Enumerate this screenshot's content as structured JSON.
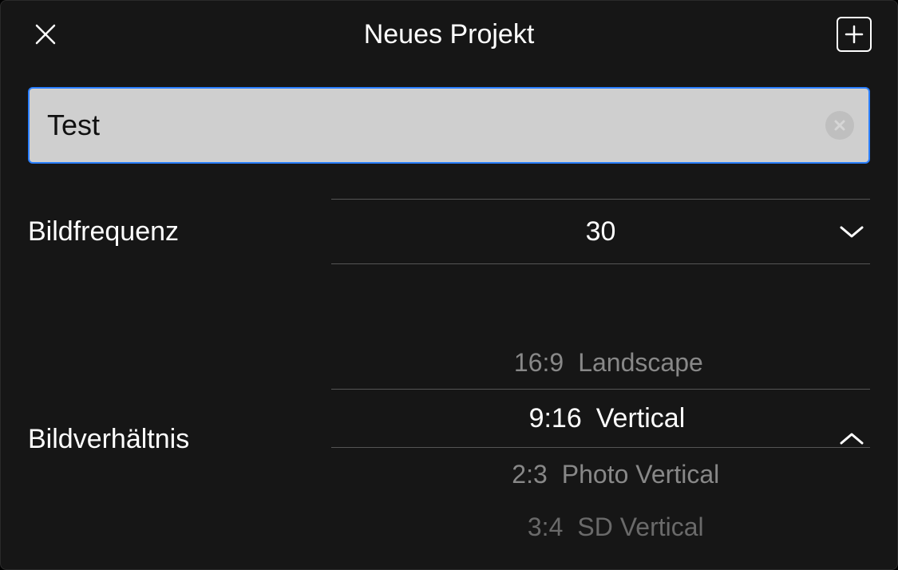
{
  "header": {
    "title": "Neues Projekt"
  },
  "project": {
    "name_value": "Test"
  },
  "framerate": {
    "label": "Bildfrequenz",
    "value": "30"
  },
  "aspect": {
    "label": "Bildverhältnis",
    "options": [
      {
        "ratio": "16:9",
        "name": "Landscape"
      },
      {
        "ratio": "9:16",
        "name": "Vertical"
      },
      {
        "ratio": "2:3",
        "name": "Photo Vertical"
      },
      {
        "ratio": "3:4",
        "name": "SD Vertical"
      }
    ],
    "selected_index": 1
  }
}
